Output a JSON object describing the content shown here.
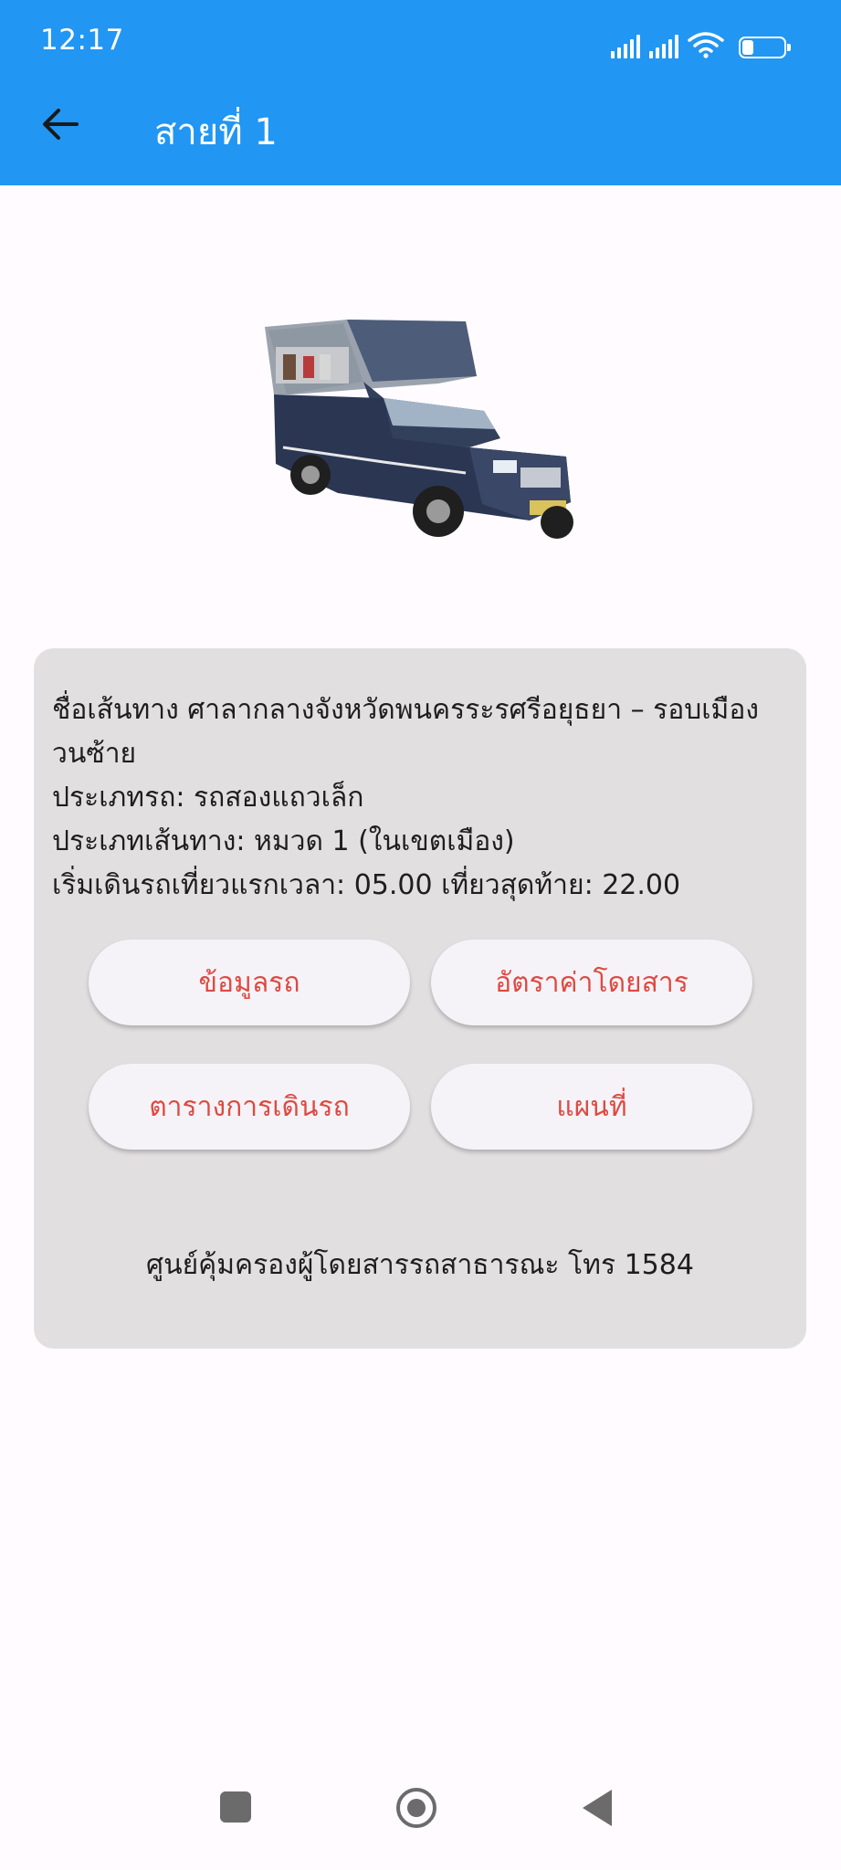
{
  "status_bar": {
    "time": "12:17",
    "battery": "27",
    "battery_level": 0.27
  },
  "app_bar": {
    "title": "สายที่ 1",
    "back_icon": "arrow-back-icon",
    "color": "#2196f3"
  },
  "route": {
    "image": "songthaew-truck",
    "name_line": "ชื่อเส้นทาง ศาลากลางจังหวัดพนครระรศรีอยุธยา – รอบเมืองวนซ้าย",
    "vehicle_type": "ประเภทรถ: รถสองแถวเล็ก",
    "route_type": "ประเภทเส้นทาง: หมวด 1 (ในเขตเมือง)",
    "schedule": "เริ่มเดินรถเที่ยวแรกเวลา: 05.00 เที่ยวสุดท้าย: 22.00"
  },
  "buttons": {
    "vehicle_info": "ข้อมูลรถ",
    "fare_rate": "อัตราค่าโดยสาร",
    "timetable": "ตารางการเดินรถ",
    "map": "แผนที่"
  },
  "accent_color": "#dd4a41",
  "hotline": "ศูนย์คุ้มครองผู้โดยสารรถสาธารณะ โทร 1584",
  "navigation_bar": {
    "recents_icon": "square-icon",
    "home_icon": "circle-home-icon",
    "back_icon": "triangle-back-icon"
  }
}
